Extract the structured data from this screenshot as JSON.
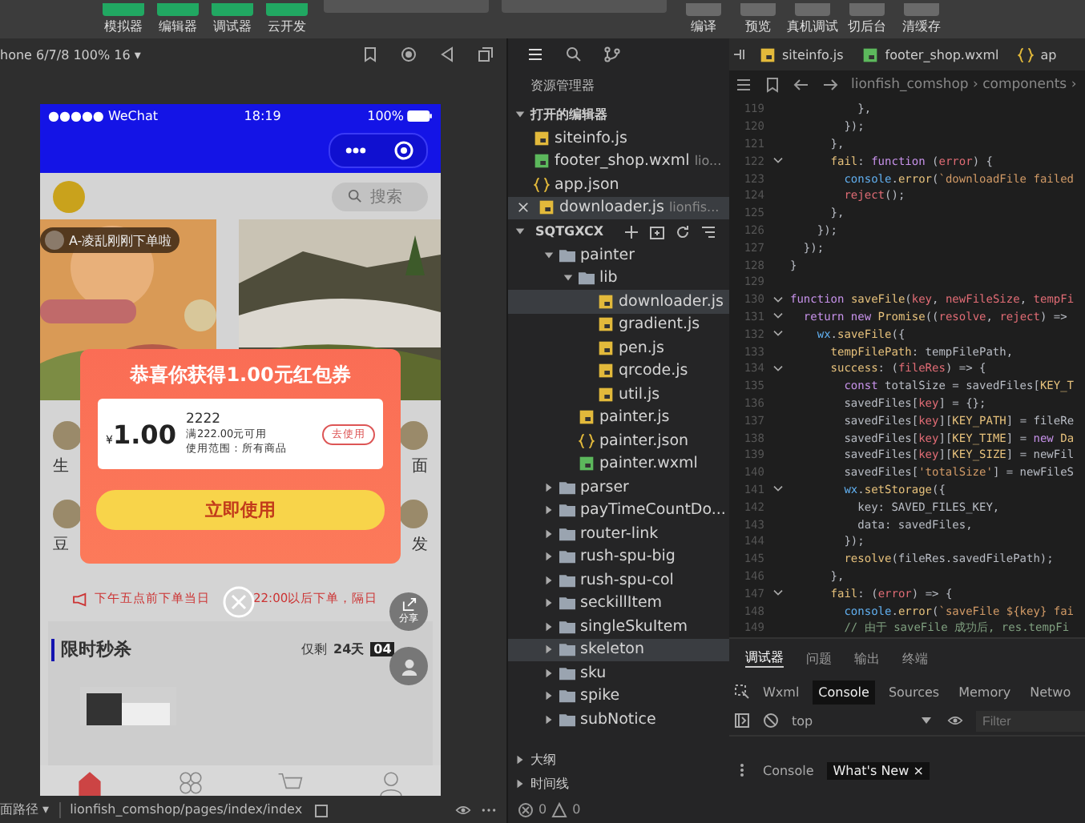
{
  "toolbar": {
    "left_buttons": [
      {
        "label": "模拟器"
      },
      {
        "label": "编辑器"
      },
      {
        "label": "调试器"
      },
      {
        "label": "云开发"
      }
    ],
    "right_buttons": [
      {
        "label": "编译"
      },
      {
        "label": "预览"
      },
      {
        "label": "真机调试"
      },
      {
        "label": "切后台"
      },
      {
        "label": "清缓存"
      }
    ]
  },
  "simulator": {
    "device": "hone 6/7/8 100% 16 ▾",
    "phone": {
      "carrier": "●●●●● WeChat",
      "time": "18:19",
      "battery": "100%",
      "search_placeholder": "搜索",
      "ticker": "A-凌乱刚刚下单啦",
      "categories": [
        {
          "label": "生"
        },
        {
          "label": "面"
        },
        {
          "label": "豆"
        },
        {
          "label": "发"
        }
      ],
      "notice": [
        "下午五点前下单当日",
        "22:00以后下单，隔日"
      ],
      "flash_sale": {
        "title": "限时秒杀",
        "remaining": "仅剩",
        "days": "24天",
        "hours": "04"
      },
      "share": "分享",
      "tabs": [
        {
          "kind": "home",
          "selected": true
        },
        {
          "kind": "category",
          "selected": false
        },
        {
          "kind": "cart",
          "selected": false
        },
        {
          "kind": "user",
          "selected": false
        }
      ],
      "popup": {
        "title": "恭喜你获得1.00元红包券",
        "currency": "¥",
        "amount": "1.00",
        "name": "2222",
        "condition": "满222.00元可用",
        "scope": "使用范围：所有商品",
        "use_button": "去使用",
        "main_button": "立即使用"
      }
    },
    "status_bar": {
      "path_label": "面路径 ▾",
      "path": "lionfish_comshop/pages/index/index"
    }
  },
  "explorer": {
    "title": "资源管理器",
    "open_editors": {
      "title": "打开的编辑器",
      "expanded": true,
      "items": [
        {
          "kind": "js",
          "name": "siteinfo.js",
          "selected": false
        },
        {
          "kind": "wxml",
          "name": "footer_shop.wxml",
          "path": "lio...",
          "selected": false
        },
        {
          "kind": "json",
          "name": "app.json",
          "selected": false
        },
        {
          "kind": "js",
          "name": "downloader.js",
          "path": "lionfis...",
          "selected": true
        }
      ]
    },
    "project": {
      "title": "SQTGXCX",
      "expanded": true,
      "tree": [
        {
          "kind": "folder",
          "name": "painter",
          "expanded": true,
          "selected": false,
          "children": [
            {
              "kind": "folder",
              "name": "lib",
              "expanded": true,
              "selected": false,
              "children": [
                {
                  "kind": "js",
                  "name": "downloader.js",
                  "selected": true
                },
                {
                  "kind": "js",
                  "name": "gradient.js",
                  "selected": false
                },
                {
                  "kind": "js",
                  "name": "pen.js",
                  "selected": false
                },
                {
                  "kind": "js",
                  "name": "qrcode.js",
                  "selected": false
                },
                {
                  "kind": "js",
                  "name": "util.js",
                  "selected": false
                }
              ]
            },
            {
              "kind": "js",
              "name": "painter.js",
              "selected": false
            },
            {
              "kind": "json",
              "name": "painter.json",
              "selected": false
            },
            {
              "kind": "wxml",
              "name": "painter.wxml",
              "selected": false
            }
          ]
        },
        {
          "kind": "folder",
          "name": "parser",
          "expanded": false,
          "selected": false
        },
        {
          "kind": "folder",
          "name": "payTimeCountDo...",
          "expanded": false,
          "selected": false
        },
        {
          "kind": "folder",
          "name": "router-link",
          "expanded": false,
          "selected": false
        },
        {
          "kind": "folder",
          "name": "rush-spu-big",
          "expanded": false,
          "selected": false
        },
        {
          "kind": "folder",
          "name": "rush-spu-col",
          "expanded": false,
          "selected": false
        },
        {
          "kind": "folder",
          "name": "seckillItem",
          "expanded": false,
          "selected": false
        },
        {
          "kind": "folder",
          "name": "singleSkuItem",
          "expanded": false,
          "selected": false
        },
        {
          "kind": "folder",
          "name": "skeleton",
          "expanded": false,
          "selected": true
        },
        {
          "kind": "folder",
          "name": "sku",
          "expanded": false,
          "selected": false
        },
        {
          "kind": "folder",
          "name": "spike",
          "expanded": false,
          "selected": false
        },
        {
          "kind": "folder",
          "name": "subNotice",
          "expanded": false,
          "selected": false
        }
      ]
    },
    "sections": [
      {
        "title": "大纲",
        "expanded": false
      },
      {
        "title": "时间线",
        "expanded": false
      }
    ],
    "errors": "0",
    "warnings": "0"
  },
  "editor": {
    "tabs": [
      {
        "kind": "js",
        "name": "siteinfo.js",
        "selected": false
      },
      {
        "kind": "wxml",
        "name": "footer_shop.wxml",
        "selected": false
      },
      {
        "kind": "json",
        "name": "ap",
        "selected": false
      }
    ],
    "breadcrumb": "lionfish_comshop › components ›",
    "lines": [
      {
        "n": "119",
        "fold": false,
        "tokens": [
          {
            "kind": "plain",
            "text": "          },"
          }
        ]
      },
      {
        "n": "120",
        "fold": false,
        "tokens": [
          {
            "kind": "plain",
            "text": "        });"
          }
        ]
      },
      {
        "n": "121",
        "fold": false,
        "tokens": [
          {
            "kind": "plain",
            "text": "      },"
          }
        ]
      },
      {
        "n": "122",
        "fold": true,
        "tokens": [
          {
            "kind": "name",
            "text": "      fail"
          },
          {
            "kind": "plain",
            "text": ": "
          },
          {
            "kind": "keyword",
            "text": "function"
          },
          {
            "kind": "plain",
            "text": " ("
          },
          {
            "kind": "param",
            "text": "error"
          },
          {
            "kind": "plain",
            "text": ") {"
          }
        ]
      },
      {
        "n": "123",
        "fold": false,
        "tokens": [
          {
            "kind": "object",
            "text": "        console"
          },
          {
            "kind": "plain",
            "text": "."
          },
          {
            "kind": "name",
            "text": "error"
          },
          {
            "kind": "plain",
            "text": "("
          },
          {
            "kind": "string",
            "text": "`downloadFile failed"
          }
        ]
      },
      {
        "n": "124",
        "fold": false,
        "tokens": [
          {
            "kind": "param",
            "text": "        reject"
          },
          {
            "kind": "plain",
            "text": "();"
          }
        ]
      },
      {
        "n": "125",
        "fold": false,
        "tokens": [
          {
            "kind": "plain",
            "text": "      },"
          }
        ]
      },
      {
        "n": "126",
        "fold": false,
        "tokens": [
          {
            "kind": "plain",
            "text": "    });"
          }
        ]
      },
      {
        "n": "127",
        "fold": false,
        "tokens": [
          {
            "kind": "plain",
            "text": "  });"
          }
        ]
      },
      {
        "n": "128",
        "fold": false,
        "tokens": [
          {
            "kind": "plain",
            "text": "}"
          }
        ]
      },
      {
        "n": "129",
        "fold": false
      },
      {
        "n": "130",
        "fold": true,
        "tokens": [
          {
            "kind": "keyword",
            "text": "function "
          },
          {
            "kind": "name",
            "text": "saveFile"
          },
          {
            "kind": "plain",
            "text": "("
          },
          {
            "kind": "param",
            "text": "key"
          },
          {
            "kind": "plain",
            "text": ", "
          },
          {
            "kind": "param",
            "text": "newFileSize"
          },
          {
            "kind": "plain",
            "text": ", "
          },
          {
            "kind": "param",
            "text": "tempFi"
          }
        ]
      },
      {
        "n": "131",
        "fold": true,
        "tokens": [
          {
            "kind": "keyword",
            "text": "  return new "
          },
          {
            "kind": "name",
            "text": "Promise"
          },
          {
            "kind": "plain",
            "text": "(("
          },
          {
            "kind": "param",
            "text": "resolve"
          },
          {
            "kind": "plain",
            "text": ", "
          },
          {
            "kind": "param",
            "text": "reject"
          },
          {
            "kind": "plain",
            "text": ") =>"
          }
        ]
      },
      {
        "n": "132",
        "fold": true,
        "tokens": [
          {
            "kind": "object",
            "text": "    wx"
          },
          {
            "kind": "plain",
            "text": "."
          },
          {
            "kind": "name",
            "text": "saveFile"
          },
          {
            "kind": "plain",
            "text": "({"
          }
        ]
      },
      {
        "n": "133",
        "fold": false,
        "tokens": [
          {
            "kind": "name",
            "text": "      tempFilePath"
          },
          {
            "kind": "plain",
            "text": ": tempFilePath,"
          }
        ]
      },
      {
        "n": "134",
        "fold": true,
        "tokens": [
          {
            "kind": "name",
            "text": "      success"
          },
          {
            "kind": "plain",
            "text": ": ("
          },
          {
            "kind": "param",
            "text": "fileRes"
          },
          {
            "kind": "plain",
            "text": ") => {"
          }
        ]
      },
      {
        "n": "135",
        "fold": false,
        "tokens": [
          {
            "kind": "keyword",
            "text": "        const "
          },
          {
            "kind": "plain",
            "text": "totalSize = savedFiles["
          },
          {
            "kind": "name",
            "text": "KEY_T"
          }
        ]
      },
      {
        "n": "136",
        "fold": false,
        "tokens": [
          {
            "kind": "plain",
            "text": "        savedFiles["
          },
          {
            "kind": "param",
            "text": "key"
          },
          {
            "kind": "plain",
            "text": "] = {};"
          }
        ]
      },
      {
        "n": "137",
        "fold": false,
        "tokens": [
          {
            "kind": "plain",
            "text": "        savedFiles["
          },
          {
            "kind": "param",
            "text": "key"
          },
          {
            "kind": "plain",
            "text": "]["
          },
          {
            "kind": "name",
            "text": "KEY_PATH"
          },
          {
            "kind": "plain",
            "text": "] = fileRe"
          }
        ]
      },
      {
        "n": "138",
        "fold": false,
        "tokens": [
          {
            "kind": "plain",
            "text": "        savedFiles["
          },
          {
            "kind": "param",
            "text": "key"
          },
          {
            "kind": "plain",
            "text": "]["
          },
          {
            "kind": "name",
            "text": "KEY_TIME"
          },
          {
            "kind": "plain",
            "text": "] = "
          },
          {
            "kind": "keyword",
            "text": "new "
          },
          {
            "kind": "name",
            "text": "Da"
          }
        ]
      },
      {
        "n": "139",
        "fold": false,
        "tokens": [
          {
            "kind": "plain",
            "text": "        savedFiles["
          },
          {
            "kind": "param",
            "text": "key"
          },
          {
            "kind": "plain",
            "text": "]["
          },
          {
            "kind": "name",
            "text": "KEY_SIZE"
          },
          {
            "kind": "plain",
            "text": "] = newFil"
          }
        ]
      },
      {
        "n": "140",
        "fold": false,
        "tokens": [
          {
            "kind": "plain",
            "text": "        savedFiles["
          },
          {
            "kind": "string",
            "text": "'totalSize'"
          },
          {
            "kind": "plain",
            "text": "] = newFileS"
          }
        ]
      },
      {
        "n": "141",
        "fold": true,
        "tokens": [
          {
            "kind": "object",
            "text": "        wx"
          },
          {
            "kind": "plain",
            "text": "."
          },
          {
            "kind": "name",
            "text": "setStorage"
          },
          {
            "kind": "plain",
            "text": "({"
          }
        ]
      },
      {
        "n": "142",
        "fold": false,
        "tokens": [
          {
            "kind": "plain",
            "text": "          key: SAVED_FILES_KEY,"
          }
        ]
      },
      {
        "n": "143",
        "fold": false,
        "tokens": [
          {
            "kind": "plain",
            "text": "          data: savedFiles,"
          }
        ]
      },
      {
        "n": "144",
        "fold": false,
        "tokens": [
          {
            "kind": "plain",
            "text": "        });"
          }
        ]
      },
      {
        "n": "145",
        "fold": false,
        "tokens": [
          {
            "kind": "name",
            "text": "        resolve"
          },
          {
            "kind": "plain",
            "text": "(fileRes.savedFilePath);"
          }
        ]
      },
      {
        "n": "146",
        "fold": false,
        "tokens": [
          {
            "kind": "plain",
            "text": "      },"
          }
        ]
      },
      {
        "n": "147",
        "fold": true,
        "tokens": [
          {
            "kind": "name",
            "text": "      fail"
          },
          {
            "kind": "plain",
            "text": ": ("
          },
          {
            "kind": "param",
            "text": "error"
          },
          {
            "kind": "plain",
            "text": ") => {"
          }
        ]
      },
      {
        "n": "148",
        "fold": false,
        "tokens": [
          {
            "kind": "object",
            "text": "        console"
          },
          {
            "kind": "plain",
            "text": "."
          },
          {
            "kind": "name",
            "text": "error"
          },
          {
            "kind": "plain",
            "text": "("
          },
          {
            "kind": "string",
            "text": "`saveFile ${key} fai"
          }
        ]
      },
      {
        "n": "149",
        "fold": false,
        "tokens": [
          {
            "kind": "comment",
            "text": "        // 由于 saveFile 成功后, res.tempFi"
          }
        ]
      }
    ]
  },
  "console": {
    "panel_tabs": [
      {
        "label": "调试器",
        "selected": true
      },
      {
        "label": "问题",
        "selected": false
      },
      {
        "label": "输出",
        "selected": false
      },
      {
        "label": "终端",
        "selected": false
      }
    ],
    "devtools_tabs": [
      {
        "label": "Wxml",
        "selected": false
      },
      {
        "label": "Console",
        "selected": true
      },
      {
        "label": "Sources",
        "selected": false
      },
      {
        "label": "Memory",
        "selected": false
      },
      {
        "label": "Netwo",
        "selected": false
      }
    ],
    "context": "top",
    "filter_placeholder": "Filter",
    "drawer_tabs": [
      {
        "label": "Console",
        "selected": false
      },
      {
        "label": "What's New ×",
        "selected": true
      }
    ]
  }
}
